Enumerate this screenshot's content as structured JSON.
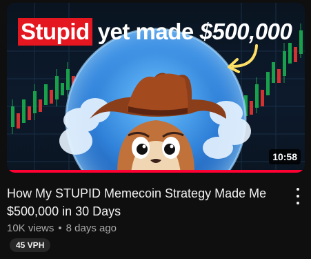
{
  "thumbnail": {
    "headline_highlight": "Stupid",
    "headline_rest": "yet made",
    "headline_money": "$500,000",
    "duration": "10:58",
    "colors": {
      "highlight_bg": "#e4161f",
      "progress": "#ff0033",
      "circle": "#2f80d8"
    },
    "progress_fraction": 1.0
  },
  "video": {
    "title": "How My STUPID Memecoin Strategy Made Me $500,000 in 30 Days",
    "views": "10K views",
    "separator": "•",
    "age": "8 days ago",
    "vph_badge": "45 VPH"
  },
  "icons": {
    "menu": "vertical-dots-icon",
    "arrow": "curved-arrow-icon"
  }
}
